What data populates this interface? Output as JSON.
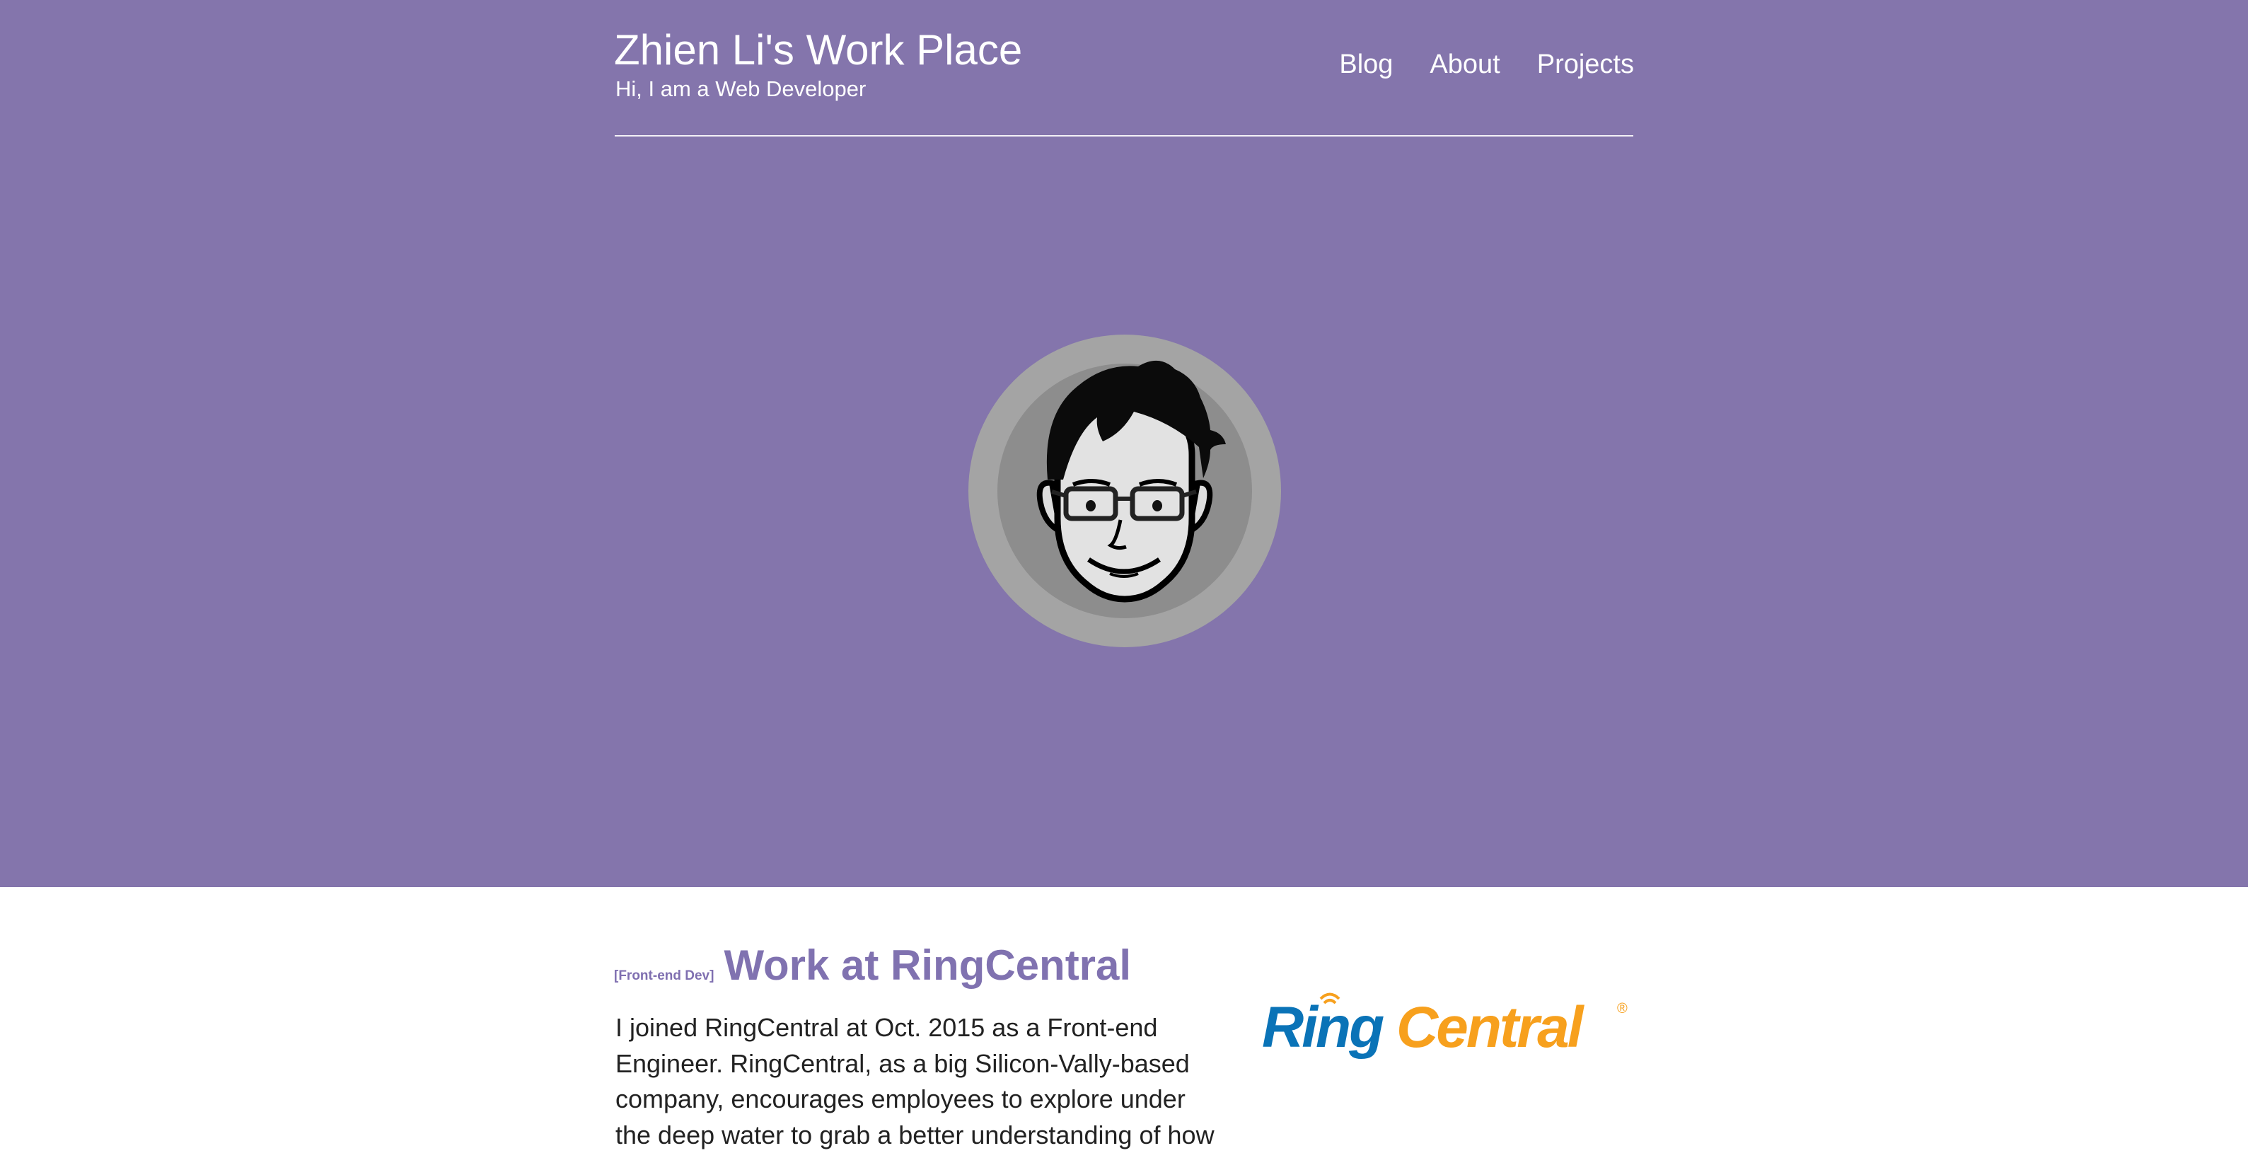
{
  "header": {
    "title": "Zhien Li's Work Place",
    "subtitle": "Hi, I am a Web Developer",
    "nav": [
      "Blog",
      "About",
      "Projects"
    ]
  },
  "post": {
    "tag": "[Front-end Dev]",
    "title": "Work at RingCentral",
    "body": "I joined RingCentral at Oct. 2015 as a Front-end Engineer. RingCentral, as a big Silicon-Vally-based company, encourages employees to explore under the deep water to grab a better understanding of how",
    "logo": {
      "text_ring": "Ring",
      "text_central": "Central",
      "registered": "®",
      "blue": "#0a73b7",
      "orange": "#f7a01d"
    }
  },
  "colors": {
    "hero_bg": "#8475ac",
    "accent": "#8072b0",
    "white": "#ffffff"
  },
  "icons": {
    "avatar": "cartoon-face-avatar-icon",
    "logo": "ringcentral-logo"
  }
}
